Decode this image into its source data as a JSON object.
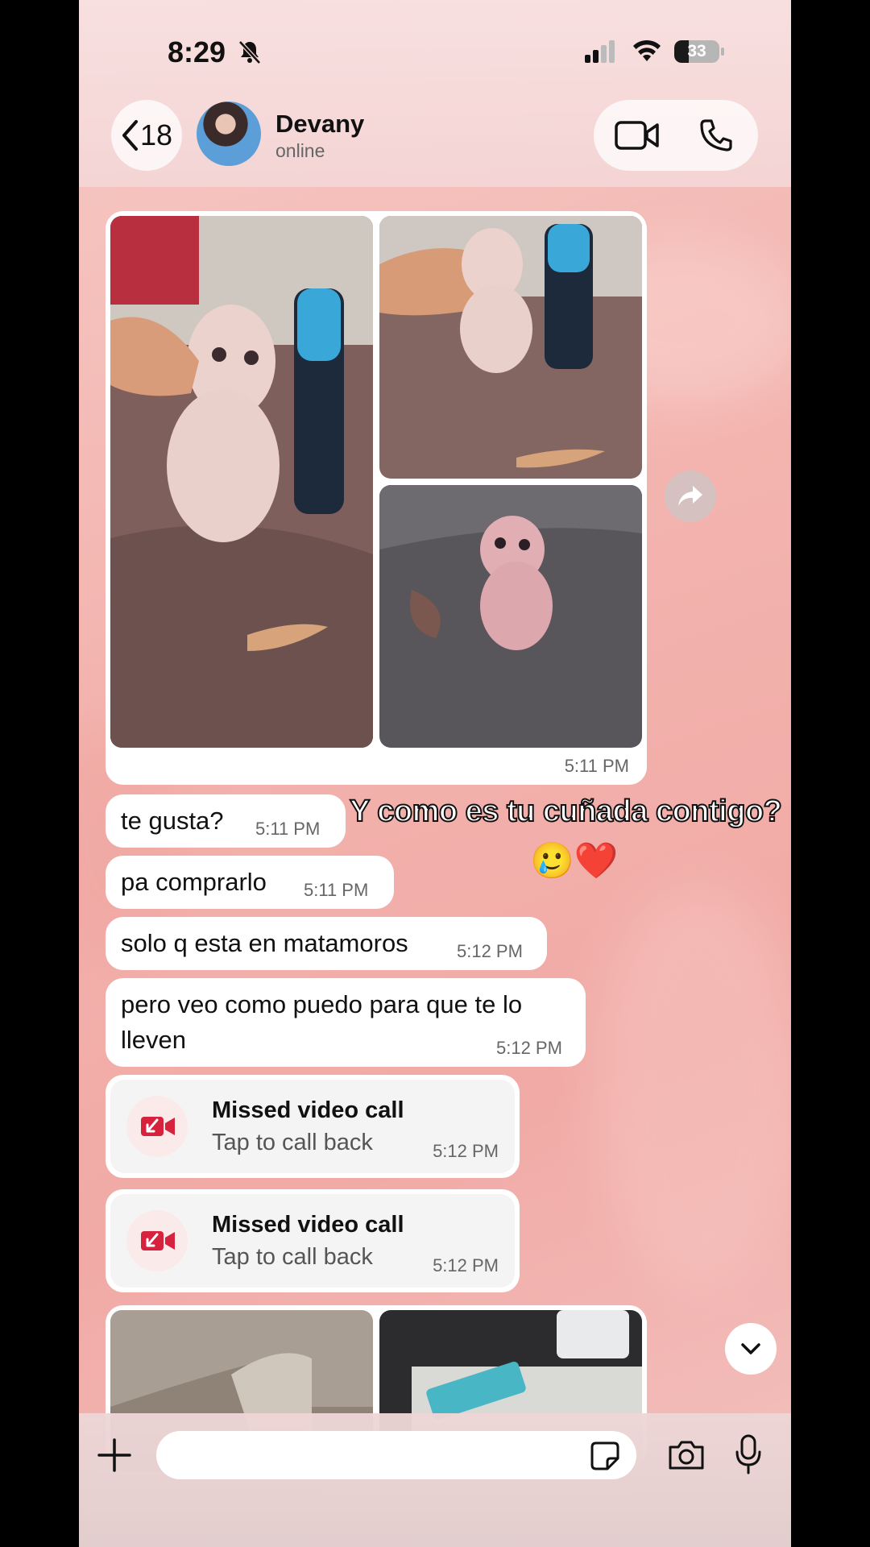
{
  "status_bar": {
    "time": "8:29",
    "battery": "33",
    "battery_level": 0.33
  },
  "header": {
    "back_count": "18",
    "contact_name": "Devany",
    "contact_status": "online"
  },
  "album": {
    "time": "5:11 PM"
  },
  "messages": [
    {
      "text": "te gusta?",
      "time": "5:11 PM"
    },
    {
      "text": "pa comprarlo",
      "time": "5:11 PM"
    },
    {
      "text": "solo q esta en matamoros",
      "time": "5:12 PM"
    },
    {
      "text": "pero veo como puedo para que te lo lleven",
      "line1": "pero veo como puedo para que te lo",
      "line2": "lleven",
      "time": "5:12 PM"
    }
  ],
  "calls": [
    {
      "title": "Missed video call",
      "subtitle": "Tap to call back",
      "time": "5:12 PM"
    },
    {
      "title": "Missed video call",
      "subtitle": "Tap to call back",
      "time": "5:12 PM"
    }
  ],
  "overlay": {
    "caption": "Y como es tu cuñada contigo?",
    "emojis": "🥲❤️"
  },
  "input": {
    "placeholder": ""
  },
  "colors": {
    "accent": "#d7223e",
    "bubble": "#ffffff",
    "background": "#f3b3ae"
  }
}
